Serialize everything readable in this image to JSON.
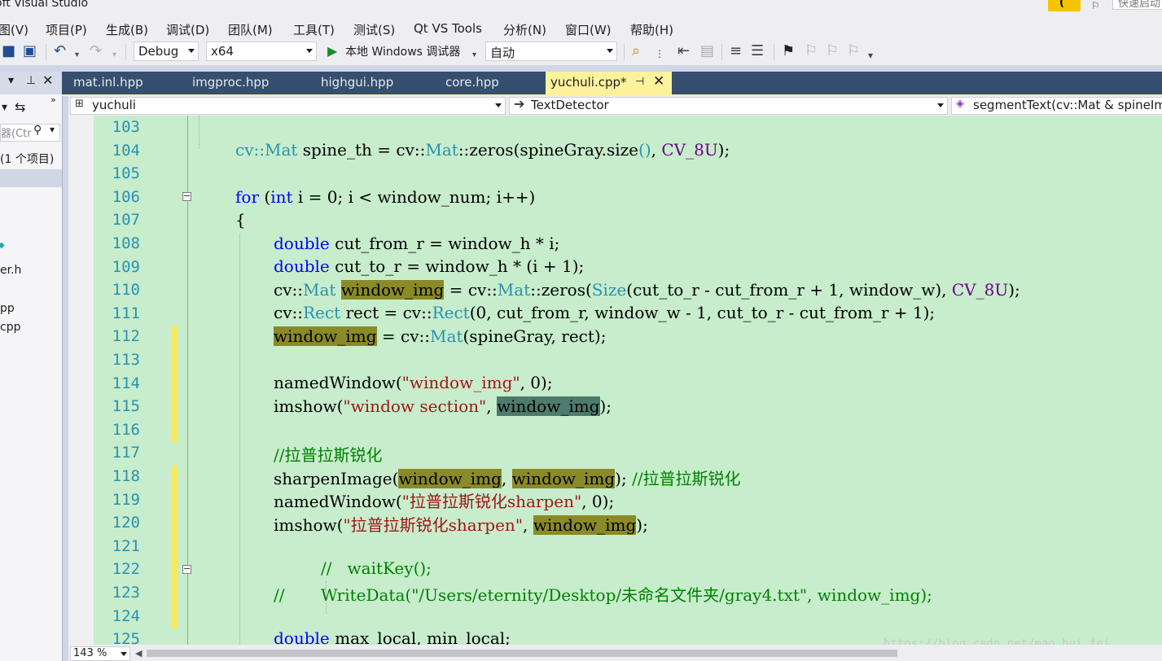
{
  "window": {
    "title": "oft Visual Studio",
    "quick_launch_placeholder": "快速启动"
  },
  "menu": [
    "图(V)",
    "项目(P)",
    "生成(B)",
    "调试(D)",
    "团队(M)",
    "工具(T)",
    "测试(S)",
    "Qt VS Tools",
    "分析(N)",
    "窗口(W)",
    "帮助(H)"
  ],
  "toolbar": {
    "configuration": "Debug",
    "platform": "x64",
    "run_label": "本地 Windows 调试器",
    "run_mode": "自动"
  },
  "left_panel": {
    "search_placeholder": "器(Ctr",
    "project_count": "(1 个项目)",
    "files": [
      "er.h",
      "pp",
      "cpp"
    ]
  },
  "tabs": [
    "mat.inl.hpp",
    "imgproc.hpp",
    "highgui.hpp",
    "core.hpp"
  ],
  "active_tab": "yuchuli.cpp*",
  "navigation": {
    "project": "yuchuli",
    "class": "TextDetector",
    "member": "segmentText(cv::Mat & spineImage"
  },
  "editor": {
    "zoom": "143 %",
    "watermark": "https://blog.csdn.net/mao_hui_fei",
    "line_numbers": [
      "103",
      "104",
      "105",
      "106",
      "107",
      "108",
      "109",
      "110",
      "111",
      "112",
      "113",
      "114",
      "115",
      "116",
      "117",
      "118",
      "119",
      "120",
      "121",
      "122",
      "123",
      "124",
      "125"
    ],
    "tokens": {
      "cv": "cv::",
      "Mat": "Mat",
      "Rect": "Rect",
      "Size": "Size",
      "for": "for",
      "int": "int",
      "double": "double",
      "CV_8U": "CV_8U",
      "window_img": "window_img",
      "l104a": " spine_th = ",
      "l104b": "::zeros(spineGray.size",
      "l104c": "()",
      "l104d": ", ",
      "l104e": ");",
      "l106a": " (",
      "l106b": " i = 0; i < window_num; i++)",
      "l107": "{",
      "l108": " cut_from_r = window_h * i;",
      "l109": " cut_to_r = window_h * (i + 1);",
      "l110a": " ",
      "l110b": " = ",
      "l110c": "::zeros(",
      "l110d": "(cut_to_r - cut_from_r + 1, window_w), ",
      "l110e": ");",
      "l111a": " rect = ",
      "l111b": "(0, cut_from_r, window_w - 1, cut_to_r - cut_from_r + 1);",
      "l112a": " = ",
      "l112b": "(spineGray, rect);",
      "namedWindow": "namedWindow(",
      "imshow": "imshow(",
      "s114": "\"window_img\"",
      "l114b": ", 0);",
      "s115": "\"window section\"",
      "sep": ", ",
      "close": ");",
      "c117": "//拉普拉斯锐化",
      "sharpen": "sharpenImage(",
      "l118b": "); ",
      "c118": "//拉普拉斯锐化",
      "s119": "\"拉普拉斯锐化sharpen\"",
      "l119b": ", 0);",
      "s120": "\"拉普拉斯锐化sharpen\"",
      "c122": "//   waitKey();",
      "c123": "//       WriteData(\"/Users/eternity/Desktop/未命名文件夹/gray4.txt\", window_img);",
      "l125b": " max_local, min_local;"
    }
  },
  "colors": {
    "editor_bg": "#c7edcc",
    "keyword": "#0000ff",
    "type": "#2b91af",
    "string": "#a31515",
    "comment": "#008000",
    "macro": "#6f008a",
    "highlight": "#8a8a27",
    "active_tab": "#fff29d"
  },
  "icons": [
    "save-icon",
    "save-all-icon",
    "undo-icon",
    "redo-icon",
    "start-debug-icon",
    "find-icon",
    "bookmark-icon",
    "pin-icon",
    "close-icon",
    "search-icon",
    "sync-icon",
    "fold-icon"
  ]
}
